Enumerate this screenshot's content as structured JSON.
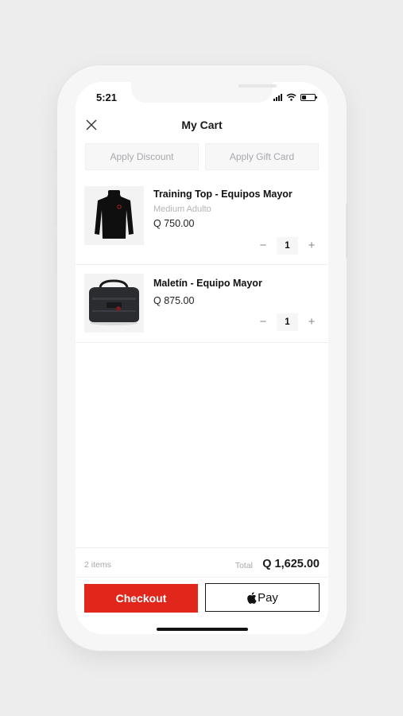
{
  "status_bar": {
    "time": "5:21"
  },
  "header": {
    "title": "My Cart"
  },
  "actions": {
    "discount_label": "Apply Discount",
    "gift_card_label": "Apply Gift Card"
  },
  "items": [
    {
      "name": "Training Top - Equipos Mayor",
      "variant": "Medium Adulto",
      "price": "Q 750.00",
      "quantity": "1",
      "image": "black long-sleeve shirt"
    },
    {
      "name": "Maletín - Equipo Mayor",
      "price": "Q 875.00",
      "quantity": "1",
      "image": "black duffel bag"
    }
  ],
  "summary": {
    "count": "2 items",
    "total_label": "Total",
    "total_value": "Q 1,625.00"
  },
  "buttons": {
    "checkout": "Checkout",
    "apple_pay": "Pay"
  },
  "colors": {
    "accent": "#e1261c",
    "muted": "#a8a8ad"
  }
}
